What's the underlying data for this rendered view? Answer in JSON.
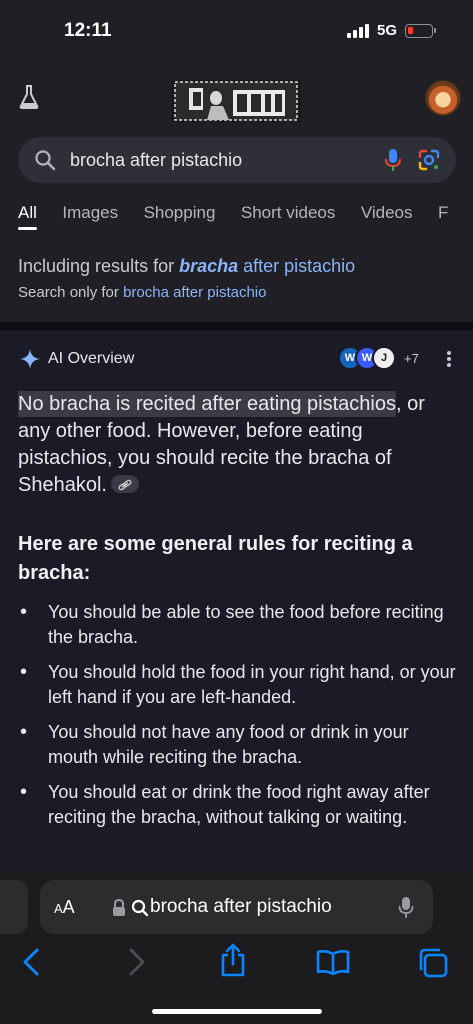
{
  "status": {
    "time": "12:11",
    "network": "5G"
  },
  "search": {
    "query": "brocha after pistachio"
  },
  "tabs": [
    {
      "label": "All"
    },
    {
      "label": "Images"
    },
    {
      "label": "Shopping"
    },
    {
      "label": "Short videos"
    },
    {
      "label": "Videos"
    },
    {
      "label": "F"
    }
  ],
  "spelling": {
    "prefix": "Including results for ",
    "corrected_bold": "bracha",
    "corrected_rest": " after pistachio",
    "only_prefix": "Search only for ",
    "only_link": "brocha after pistachio"
  },
  "ai_overview": {
    "title": "AI Overview",
    "more_sources": "+7",
    "source_icons": [
      "W",
      "W",
      "J"
    ],
    "para_highlight": "No bracha is recited after eating pistachios",
    "para_rest": ", or any other food. However, before eating pistachios, you should recite the bracha of Shehakol.",
    "heading": "Here are some general rules for reciting a bracha:",
    "bullets": [
      "You should be able to see the food before reciting the bracha.",
      "You should hold the food in your right hand, or your left hand if you are left-handed.",
      "You should not have any food or drink in your mouth while reciting the bracha.",
      "You should eat or drink the food right away after reciting the bracha, without talking or waiting."
    ]
  },
  "browser": {
    "aa_label_small": "A",
    "aa_label": "A",
    "url_text": "brocha after pistachio"
  },
  "colors": {
    "accent": "#8ab4f8",
    "battery_low": "#ff3b30",
    "toolbar_blue": "#0a84ff"
  }
}
